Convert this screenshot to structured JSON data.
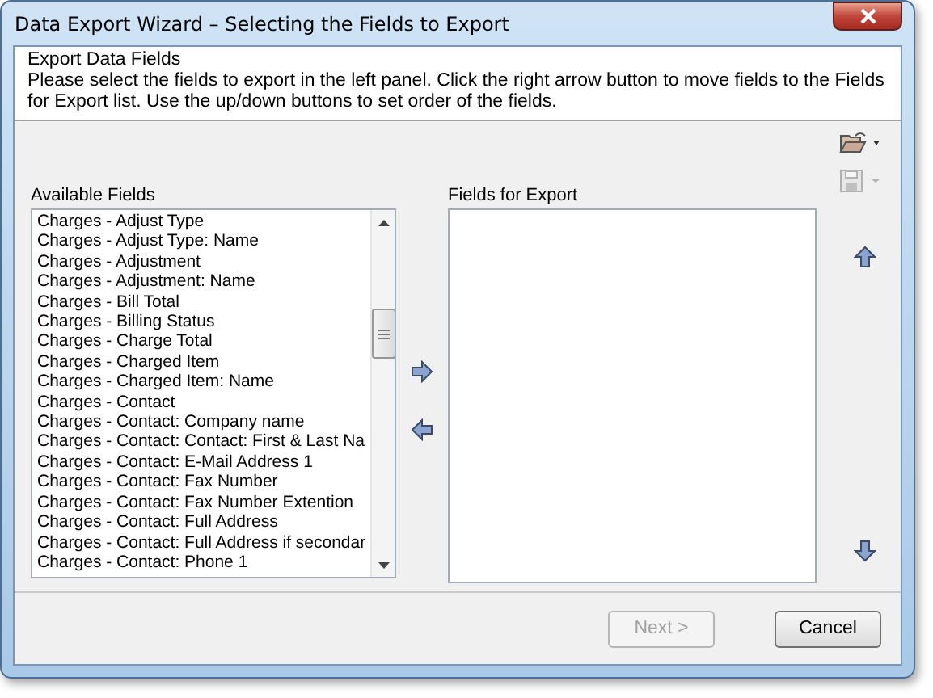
{
  "window": {
    "title": "Data Export Wizard – Selecting the Fields to Export"
  },
  "header": {
    "title": "Export Data Fields",
    "description": "Please select the fields to export in the left panel. Click the right arrow button to move fields to the Fields for Export list. Use the up/down buttons to set order of the fields."
  },
  "toolbar": {
    "save_disabled": true
  },
  "available": {
    "label": "Available Fields",
    "items": [
      "Charges - Adjust Type",
      "Charges - Adjust Type: Name",
      "Charges - Adjustment",
      "Charges - Adjustment: Name",
      "Charges - Bill Total",
      "Charges - Billing Status",
      "Charges - Charge Total",
      "Charges - Charged Item",
      "Charges - Charged Item: Name",
      "Charges - Contact",
      "Charges - Contact: Company name",
      "Charges - Contact: Contact: First & Last Na",
      "Charges - Contact: E-Mail Address 1",
      "Charges - Contact: Fax Number",
      "Charges - Contact: Fax Number Extention",
      "Charges - Contact: Full Address",
      "Charges - Contact: Full Address if secondar",
      "Charges - Contact: Phone 1"
    ]
  },
  "export": {
    "label": "Fields for Export"
  },
  "buttons": [
    {
      "label": "Next >",
      "disabled": true
    },
    {
      "label": "Cancel",
      "disabled": false
    }
  ]
}
